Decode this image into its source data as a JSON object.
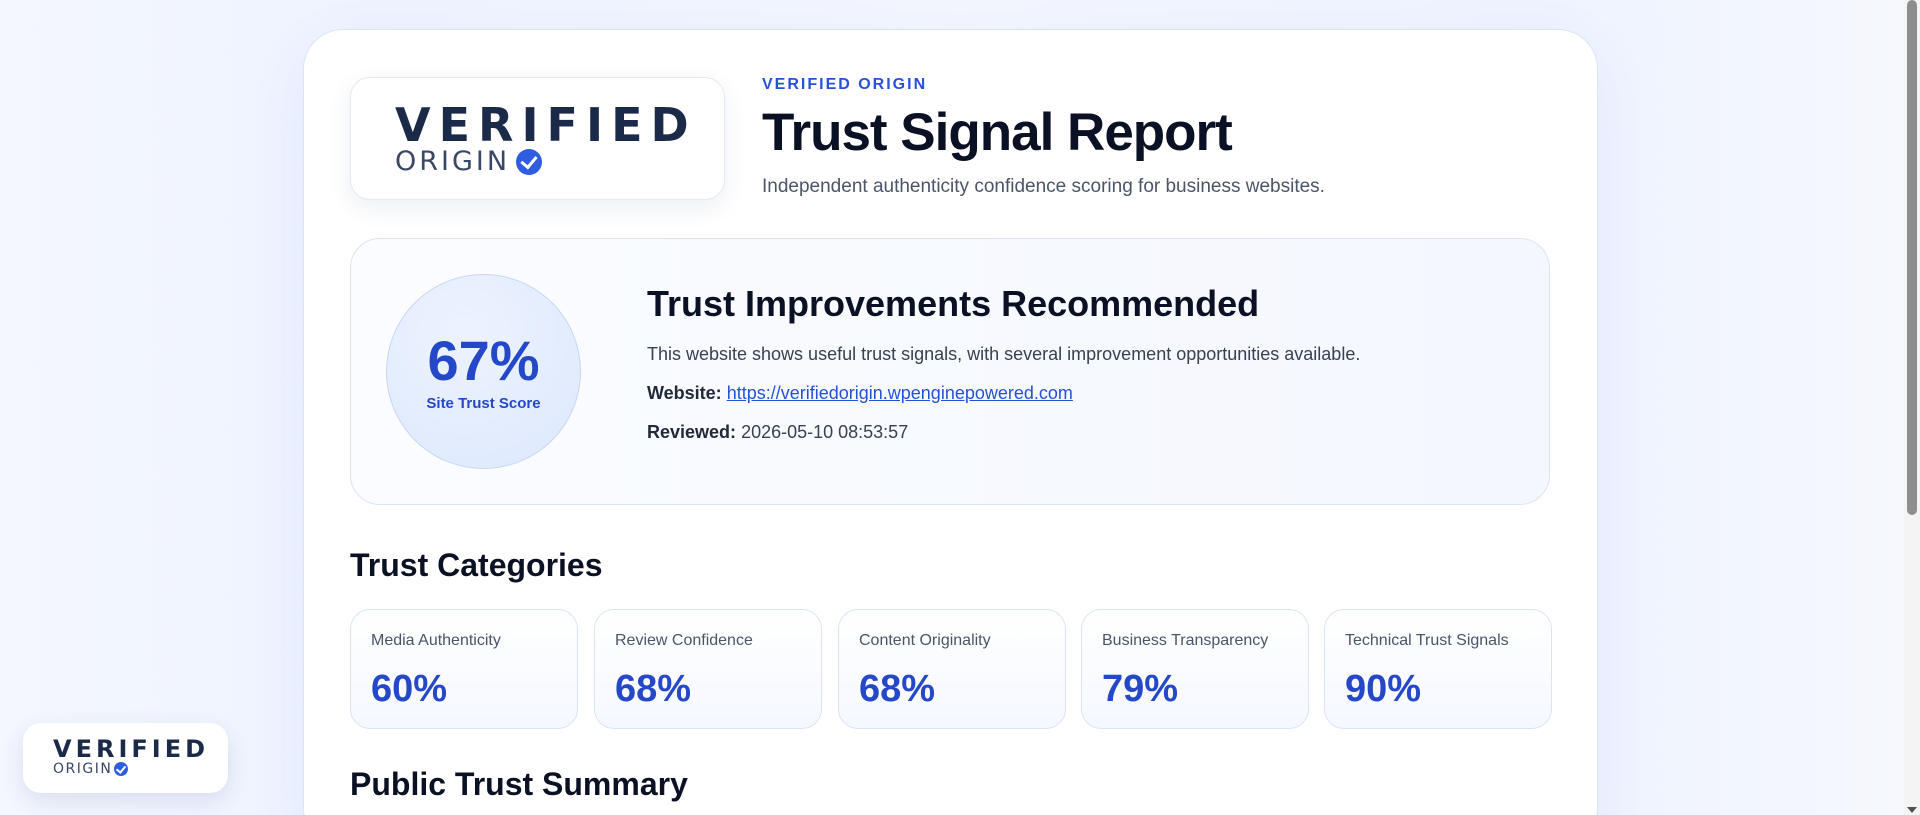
{
  "brand": {
    "logo_word": "VERIFIED",
    "logo_sub": "ORIGIN",
    "logo_icon": "check-circle-icon"
  },
  "header": {
    "eyebrow": "VERIFIED ORIGIN",
    "title": "Trust Signal Report",
    "subtitle": "Independent authenticity confidence scoring for business websites."
  },
  "score": {
    "value": "67%",
    "label": "Site Trust Score",
    "heading": "Trust Improvements Recommended",
    "description": "This website shows useful trust signals, with several improvement opportunities available.",
    "website_label": "Website:",
    "website_url": "https://verifiedorigin.wpenginepowered.com",
    "reviewed_label": "Reviewed:",
    "reviewed_value": "2026-05-10 08:53:57"
  },
  "categories_title": "Trust Categories",
  "categories": [
    {
      "label": "Media Authenticity",
      "value": "60%"
    },
    {
      "label": "Review Confidence",
      "value": "68%"
    },
    {
      "label": "Content Originality",
      "value": "68%"
    },
    {
      "label": "Business Transparency",
      "value": "79%"
    },
    {
      "label": "Technical Trust Signals",
      "value": "90%"
    }
  ],
  "summary_title": "Public Trust Summary",
  "floating_badge": {
    "word": "VERIFIED",
    "sub": "ORIGIN"
  },
  "colors": {
    "accent": "#2448c8",
    "heading": "#0b1124",
    "border": "#dbe4f5"
  }
}
